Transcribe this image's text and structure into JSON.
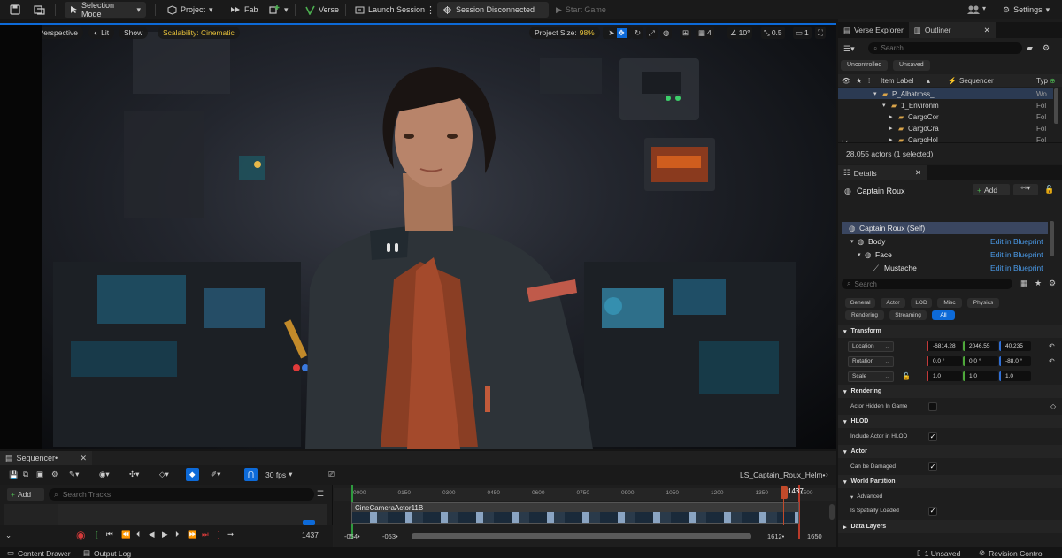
{
  "toolbar": {
    "selection_mode": "Selection Mode",
    "project": "Project",
    "fab": "Fab",
    "verse": "Verse",
    "launch_session": "Launch Session",
    "session_status": "Session Disconnected",
    "start_game": "Start Game",
    "settings": "Settings"
  },
  "viewport": {
    "perspective": "Perspective",
    "lit": "Lit",
    "show": "Show",
    "scalability": "Scalability: Cinematic",
    "project_size_label": "Project Size:",
    "project_size_value": "98%",
    "grid_value": "4",
    "angle_value": "10°",
    "scale_value": "0.5",
    "camera_count": "1"
  },
  "sequencer": {
    "tab": "Sequencer•",
    "fps": "30 fps",
    "sequence_name": "LS_Captain_Roux_Helm•",
    "add": "Add",
    "search_placeholder": "Search Tracks",
    "track_name": "CineCameraActor11B",
    "current_frame": "1437",
    "playhead_label": "1437",
    "ruler_ticks": [
      "0000",
      "0150",
      "0300",
      "0450",
      "0600",
      "0750",
      "0900",
      "1050",
      "1200",
      "1350",
      "1500"
    ],
    "range_start_a": "-054•",
    "range_start_b": "-053•",
    "range_end_a": "1612•",
    "range_end_b": "1650"
  },
  "outliner": {
    "tab_verse": "Verse Explorer",
    "tab_outliner": "Outliner",
    "search_placeholder": "Search...",
    "filter_uncontrolled": "Uncontrolled",
    "filter_unsaved": "Unsaved",
    "col_label": "Item Label",
    "col_sequencer": "Sequencer",
    "col_type": "Typ",
    "rows": [
      {
        "label": "P_Albatross_",
        "type": "Wo"
      },
      {
        "label": "1_Environm",
        "type": "Fol"
      },
      {
        "label": "CargoCor",
        "type": "Fol"
      },
      {
        "label": "CargoCra",
        "type": "Fol"
      },
      {
        "label": "CargoHol",
        "type": "Fol"
      }
    ],
    "count": "28,055 actors (1 selected)"
  },
  "details": {
    "tab": "Details",
    "actor_name": "Captain Roux",
    "add": "Add",
    "components": [
      {
        "label": "Captain Roux (Self)",
        "link": ""
      },
      {
        "label": "Body",
        "link": "Edit in Blueprint"
      },
      {
        "label": "Face",
        "link": "Edit in Blueprint"
      },
      {
        "label": "Mustache",
        "link": "Edit in Blueprint"
      }
    ],
    "search_placeholder": "Search",
    "filters_row1": [
      "General",
      "Actor",
      "LOD",
      "Misc",
      "Physics"
    ],
    "filters_row2": [
      "Rendering",
      "Streaming",
      "All"
    ],
    "transform": {
      "title": "Transform",
      "location_label": "Location",
      "location": [
        "-6814.28",
        "2046.55",
        "40.235"
      ],
      "rotation_label": "Rotation",
      "rotation": [
        "0.0 °",
        "0.0 °",
        "-88.0 °"
      ],
      "scale_label": "Scale",
      "scale": [
        "1.0",
        "1.0",
        "1.0"
      ]
    },
    "rendering": {
      "title": "Rendering",
      "hidden_label": "Actor Hidden In Game",
      "hidden": false
    },
    "hlod": {
      "title": "HLOD",
      "include_label": "Include Actor in HLOD",
      "include": true
    },
    "actor": {
      "title": "Actor",
      "damaged_label": "Can be Damaged",
      "damaged": true
    },
    "world_partition": {
      "title": "World Partition",
      "advanced": "Advanced",
      "spatial_label": "Is Spatially Loaded",
      "spatial": true
    },
    "data_layers": {
      "title": "Data Layers"
    }
  },
  "status": {
    "content_drawer": "Content Drawer",
    "output_log": "Output Log",
    "unsaved": "1 Unsaved",
    "revision": "Revision Control"
  },
  "colors": {
    "accent": "#0d6ad8",
    "seq_playhead": "#c24a2a",
    "panel_bg": "#1c1c1c"
  }
}
